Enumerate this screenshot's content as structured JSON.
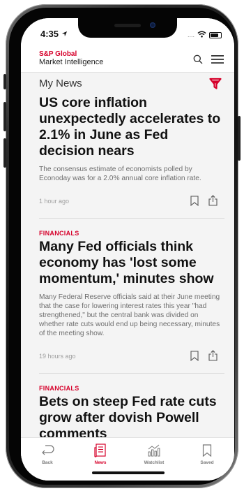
{
  "colors": {
    "brand_red": "#d6002a",
    "text_dark": "#111111",
    "text_muted": "#6e6e6e",
    "screen_bg": "#f4f4f4"
  },
  "status_bar": {
    "time": "4:35",
    "signal": "....",
    "icons": [
      "location-arrow-icon",
      "wifi-icon",
      "battery-icon"
    ]
  },
  "header": {
    "logo_line1": "S&P Global",
    "logo_line2": "Market Intelligence",
    "icons": [
      "search-icon",
      "hamburger-menu-icon"
    ]
  },
  "section": {
    "title": "My News",
    "filter_icon": "filter-icon"
  },
  "articles": [
    {
      "category": "",
      "headline": "US core inflation unexpectedly accelerates to 2.1% in June as Fed decision nears",
      "summary": "The consensus estimate of economists polled by Econoday was for a 2.0% annual core inflation rate.",
      "timestamp": "1 hour ago"
    },
    {
      "category": "FINANCIALS",
      "headline": "Many Fed officials think economy has 'lost some momentum,' minutes show",
      "summary": "Many Federal Reserve officials said at their June meeting that the case for lowering interest rates this year \"had strengthened,\" but the central bank was divided on whether rate cuts would end up being necessary, minutes of the meeting show.",
      "timestamp": "19 hours ago"
    },
    {
      "category": "FINANCIALS",
      "headline": "Bets on steep Fed rate cuts grow after dovish Powell comments",
      "summary": "",
      "timestamp": ""
    }
  ],
  "tabs": [
    {
      "label": "Back",
      "icon": "back-arrow-icon",
      "active": false
    },
    {
      "label": "News",
      "icon": "news-icon",
      "active": true
    },
    {
      "label": "Watchlist",
      "icon": "watchlist-chart-icon",
      "active": false
    },
    {
      "label": "Saved",
      "icon": "bookmark-icon",
      "active": false
    }
  ]
}
